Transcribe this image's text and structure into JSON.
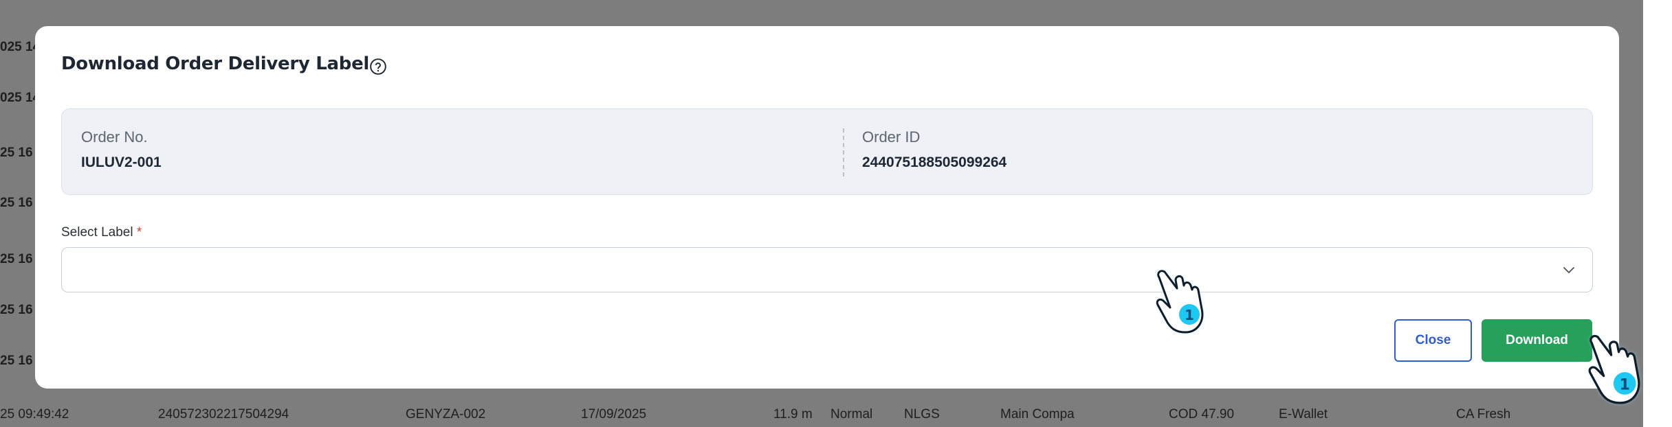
{
  "background": {
    "left_column": [
      "025 14",
      "025 14",
      "25 16",
      "25 16",
      "25 16",
      "25 16",
      "25 16"
    ],
    "bottom_row": [
      "25 09:49:42",
      "240572302217504294",
      "GENYZA-002",
      "17/09/2025",
      "11.9 m",
      "Normal",
      "NLGS",
      "Main Compa",
      "COD 47.90",
      "E-Wallet",
      "CA Fresh"
    ]
  },
  "modal": {
    "title": "Download Order Delivery Label",
    "help_icon": "help-circle-icon",
    "order_no_label": "Order No.",
    "order_no_value": "IULUV2-001",
    "order_id_label": "Order ID",
    "order_id_value": "244075188505099264",
    "select_label": "Select Label",
    "required_mark": "*",
    "select_value": "",
    "close_label": "Close",
    "download_label": "Download"
  },
  "colors": {
    "primary": "#2f5ec9",
    "success": "#26a05a",
    "required": "#e53935",
    "cursor": "#1ec8f0"
  },
  "cursors": [
    {
      "name": "pointer-hand-cursor-1",
      "badge": "1"
    },
    {
      "name": "pointer-hand-cursor-2",
      "badge": "1"
    }
  ]
}
